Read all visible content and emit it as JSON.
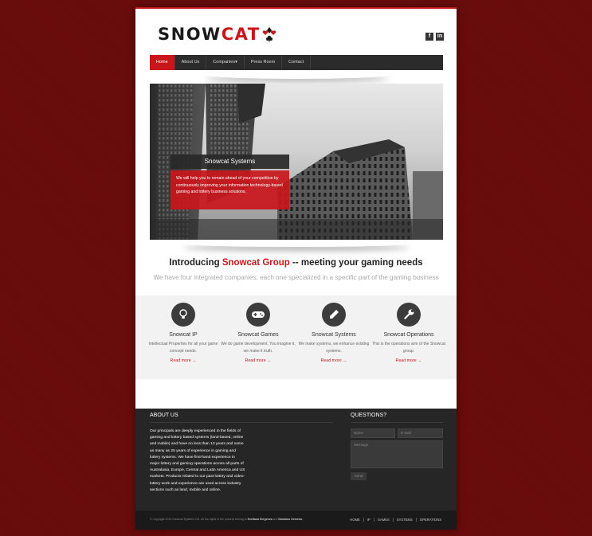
{
  "brand": {
    "name_part1": "SNOW",
    "name_part2": "CAT",
    "accent": "#c8161b"
  },
  "social": [
    {
      "icon": "facebook-icon",
      "label": "f"
    },
    {
      "icon": "linkedin-icon",
      "label": "in"
    }
  ],
  "nav": {
    "items": [
      "Home",
      "About Us",
      "Companies▾",
      "Press Room",
      "Contact"
    ],
    "active": "Home"
  },
  "hero": {
    "title": "Snowcat Systems",
    "text": "We will help you to remain ahead of your competition by continuously improving your information technology-based gaming and lottery business solutions."
  },
  "intro": {
    "title_pre": "Introducing",
    "title_highlight": "Snowcat Group",
    "title_post": "-- meeting your gaming needs",
    "subtitle": "We have four integrated companies, each one specialized in a specific part of the gaming business"
  },
  "features": [
    {
      "icon": "lightbulb-icon",
      "title": "Snowcat IP",
      "desc": "Intellectual Properties for all your game concept needs.",
      "more": "Read more →"
    },
    {
      "icon": "gamepad-icon",
      "title": "Snowcat Games",
      "desc": "We do game development. You imagine it, we make it truth.",
      "more": "Read more →"
    },
    {
      "icon": "pencil-icon",
      "title": "Snowcat Systems",
      "desc": "We make systems, we enhance existing systems.",
      "more": "Read more →"
    },
    {
      "icon": "wrench-icon",
      "title": "Snowcat Operations",
      "desc": "This is the operations arm of the Snowcat group.",
      "more": "Read more →"
    }
  ],
  "footer": {
    "about_title": "ABOUT US",
    "about_text": "Our principals are deeply experienced in the fields of gaming and lottery based systems (land-based, online and mobile) and have no less than 13 years and some as many as 25 years of experience in gaming and lottery systems. We have first-hand experience in major lottery and gaming operations across all parts of Australasia, Europe, Central and Latin America and US markets. Products related to our past lottery and video-lottery work and experience are used across industry sections such as land, mobile and online.",
    "questions_title": "QUESTIONS?",
    "name_placeholder": "Name",
    "email_placeholder": "E-mail",
    "message_placeholder": "Message",
    "send_label": "Send",
    "copyright_pre": "© Copyright 2014 Snowcat Systems OÜ. All the rights of the pictures belong to",
    "copyright_name1": "Svetlana Sergeeva",
    "copyright_and": "and",
    "copyright_name2": "Damiano Gemeno.",
    "links": [
      "HOME",
      "IP",
      "GAMES",
      "SYSTEMS",
      "OPERATIONS"
    ]
  }
}
